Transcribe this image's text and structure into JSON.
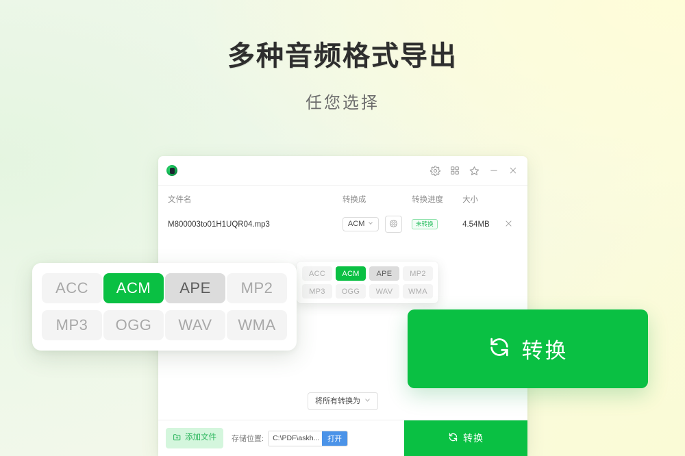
{
  "hero": {
    "title": "多种音频格式导出",
    "subtitle": "任您选择"
  },
  "app_window": {
    "titlebar": {
      "logo_icon": "app-logo-icon",
      "controls": [
        {
          "icon": "gear-icon"
        },
        {
          "icon": "grid-icon"
        },
        {
          "icon": "star-icon"
        },
        {
          "icon": "minimize-icon"
        },
        {
          "icon": "close-icon"
        }
      ]
    },
    "table": {
      "headers": {
        "name": "文件名",
        "convert_to": "转换成",
        "progress": "转换进度",
        "size": "大小"
      },
      "rows": [
        {
          "name": "M800003to01H1UQR04.mp3",
          "format": "ACM",
          "status": "未转换",
          "size": "4.54MB",
          "remove_icon": "close-icon",
          "settings_icon": "gear-icon",
          "dropdown_icon": "chevron-down-icon"
        }
      ]
    },
    "format_popup": {
      "options": [
        {
          "label": "ACC",
          "state": "normal"
        },
        {
          "label": "ACM",
          "state": "active"
        },
        {
          "label": "APE",
          "state": "hovered"
        },
        {
          "label": "MP2",
          "state": "normal"
        },
        {
          "label": "MP3",
          "state": "normal"
        },
        {
          "label": "OGG",
          "state": "normal"
        },
        {
          "label": "WAV",
          "state": "normal"
        },
        {
          "label": "WMA",
          "state": "normal"
        }
      ]
    },
    "convert_all": {
      "label": "将所有转换为",
      "icon": "chevron-down-icon"
    },
    "footer": {
      "add_file_label": "添加文件",
      "add_file_icon": "folder-add-icon",
      "save_location_label": "存储位置:",
      "save_location_value": "C:\\PDF\\askh...",
      "open_button_label": "打开",
      "convert_label": "转换",
      "convert_icon": "refresh-icon"
    }
  },
  "format_card": {
    "options": [
      {
        "label": "ACC",
        "state": "normal"
      },
      {
        "label": "ACM",
        "state": "active"
      },
      {
        "label": "APE",
        "state": "hovered"
      },
      {
        "label": "MP2",
        "state": "normal"
      },
      {
        "label": "MP3",
        "state": "normal"
      },
      {
        "label": "OGG",
        "state": "normal"
      },
      {
        "label": "WAV",
        "state": "normal"
      },
      {
        "label": "WMA",
        "state": "normal"
      }
    ]
  },
  "cta": {
    "label": "转换",
    "icon": "refresh-icon"
  },
  "colors": {
    "brand_green": "#0ac043",
    "badge_green": "#24bd5c",
    "open_blue": "#4b93e8",
    "add_file_bg": "#d4f6dd",
    "chip_bg": "#f4f4f4",
    "chip_hover_bg": "#dcdcdc"
  }
}
